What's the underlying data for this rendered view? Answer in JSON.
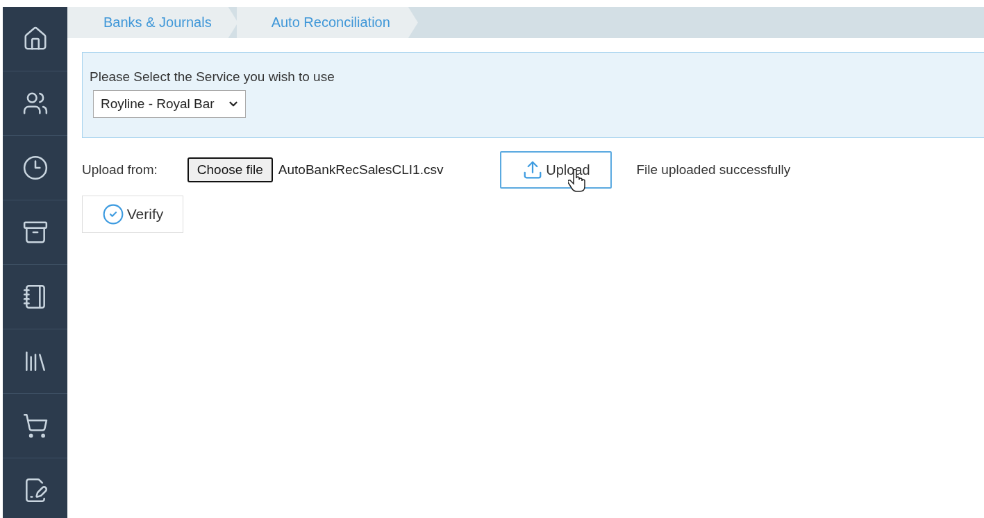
{
  "breadcrumbs": [
    "Banks & Journals",
    "Auto Reconciliation"
  ],
  "service": {
    "label": "Please Select the Service you wish to use",
    "value": "Royline - Royal Bar"
  },
  "upload": {
    "label": "Upload from:",
    "choose_button": "Choose file",
    "file_name": "AutoBankRecSalesCLI1.csv",
    "upload_button": "Upload",
    "status": "File uploaded successfully"
  },
  "verify_button": "Verify"
}
